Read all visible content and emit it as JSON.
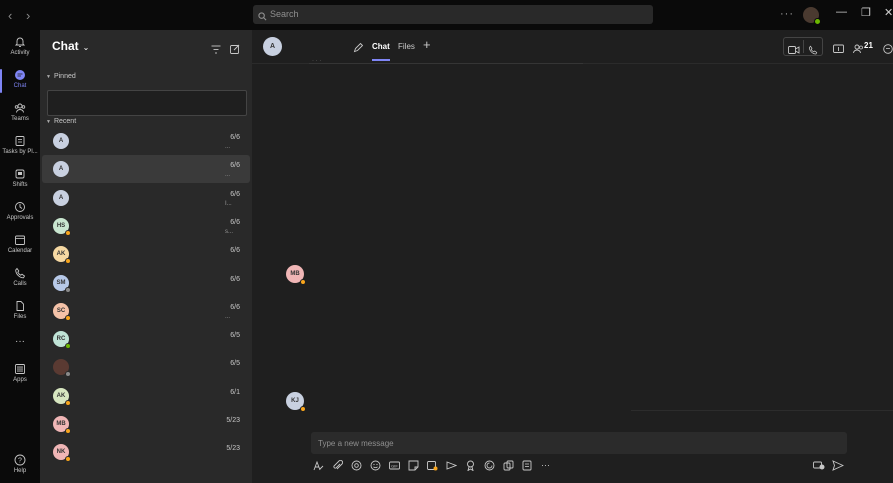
{
  "titlebar": {
    "back_icon": "chevron-left-icon",
    "forward_icon": "chevron-right-icon",
    "search_placeholder": "Search",
    "more": "···"
  },
  "rail": {
    "items": [
      {
        "label": "Activity",
        "icon": "bell-icon"
      },
      {
        "label": "Chat",
        "icon": "chat-icon",
        "active": true
      },
      {
        "label": "Teams",
        "icon": "teams-icon"
      },
      {
        "label": "Tasks by Pl...",
        "icon": "tasks-icon"
      },
      {
        "label": "Shifts",
        "icon": "shifts-icon"
      },
      {
        "label": "Approvals",
        "icon": "approvals-icon"
      },
      {
        "label": "Calendar",
        "icon": "calendar-icon"
      },
      {
        "label": "Calls",
        "icon": "phone-icon"
      },
      {
        "label": "Files",
        "icon": "file-icon"
      },
      {
        "label": "···",
        "icon": "more-icon"
      },
      {
        "label": "Apps",
        "icon": "apps-icon"
      },
      {
        "label": "Help",
        "icon": "help-icon"
      }
    ]
  },
  "panel": {
    "title": "Chat",
    "pinned_label": "Pinned",
    "recent_label": "Recent",
    "chats": [
      {
        "initials": "A",
        "date": "6/6",
        "preview": "...",
        "color": "#c8d0e0",
        "status": ""
      },
      {
        "initials": "A",
        "date": "6/6",
        "preview": "...",
        "color": "#c8d0e0",
        "status": "",
        "selected": true
      },
      {
        "initials": "A",
        "date": "6/6",
        "preview": "I...",
        "color": "#c8d0e0",
        "status": ""
      },
      {
        "initials": "HS",
        "date": "6/6",
        "preview": "s...",
        "color": "#c9e6d0",
        "status": "#f8a51c"
      },
      {
        "initials": "AK",
        "date": "6/6",
        "preview": "",
        "color": "#f6d9a3",
        "status": "#f8a51c"
      },
      {
        "initials": "SM",
        "date": "6/6",
        "preview": "",
        "color": "#b7c9e8",
        "status": "#8a8a8a"
      },
      {
        "initials": "SC",
        "date": "6/6",
        "preview": "...",
        "color": "#f4c2a8",
        "status": "#f8a51c"
      },
      {
        "initials": "RC",
        "date": "6/5",
        "preview": "",
        "color": "#bfe3d6",
        "status": "#6bb700"
      },
      {
        "initials": "",
        "date": "6/5",
        "preview": "",
        "color": "#5a3a32",
        "status": "#8a8a8a"
      },
      {
        "initials": "AK",
        "date": "6/1",
        "preview": "",
        "color": "#d7e6c0",
        "status": "#f8a51c"
      },
      {
        "initials": "MB",
        "date": "5/23",
        "preview": "",
        "color": "#f0b6b6",
        "status": "#f8a51c"
      },
      {
        "initials": "NK",
        "date": "5/23",
        "preview": "",
        "color": "#f0b6b6",
        "status": "#f8a51c"
      }
    ]
  },
  "header": {
    "avatar_initials": "A",
    "tabs": [
      {
        "label": "Chat",
        "active": true
      },
      {
        "label": "Files",
        "active": false
      }
    ],
    "people_count": "21"
  },
  "messages": [
    {
      "initials": "MB",
      "color": "#f0b6b6"
    },
    {
      "initials": "KJ",
      "color": "#c8d0e0"
    }
  ],
  "compose": {
    "placeholder": "Type a new message"
  },
  "colors": {
    "accent": "#7f85f5",
    "away": "#f8a51c",
    "available": "#6bb700"
  }
}
